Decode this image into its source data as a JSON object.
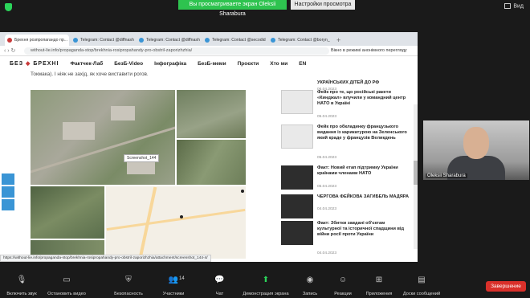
{
  "zoom": {
    "banner": "Вы просматриваете экран Oleksii Sharabura",
    "view_options": "Настройки просмотра",
    "view_mode": "Вид"
  },
  "browser": {
    "tabs": [
      {
        "label": "Брехня розпропагандо пр...",
        "active": true
      },
      {
        "label": "Telegram: Contact @diffnash"
      },
      {
        "label": "Telegram: Contact @diffnash"
      },
      {
        "label": "Telegram: Contact @secodid"
      },
      {
        "label": "Telegram: Contact @boryn_"
      }
    ],
    "new_tab": "+",
    "url": "without-lie.info/propaganda-stop/brekhnia-rosipropahandy-pro-obstril-zaporizhzhia/",
    "incognito": "Вікно в режимі анонімного перегляду",
    "status_url": "https://without-lie.info/propaganda-stop/brekhnia-rosipropahandy-pro-obstril-zaporizhzhia/attachment/screenshot_144-4/"
  },
  "site": {
    "logo_left": "БЕЗ",
    "logo_right": "БРЕХНІ",
    "nav": [
      "Фактчек-Лаб",
      "БезБ-Video",
      "Інфографіка",
      "БезБ-меми",
      "Проєкти",
      "Хто ми",
      "EN"
    ],
    "intro_text": "Токмака). І ніяк не захід, як хоче виставити рогов.",
    "tooltip": "Screenshot_144",
    "sidebar": [
      {
        "title": "УКРАЇНСЬКИХ ДІТЕЙ ДО РФ",
        "date": "06.04.2023"
      },
      {
        "title": "Фейк про те, що російські ракети «Кинджал» влучили у командний центр НАТО в Україні",
        "date": "05.04.2023"
      },
      {
        "title": "Фейк про обкладинку французького видання із карикатурою на Зеленського який краде у французів Великдень",
        "date": "05.04.2023"
      },
      {
        "title": "Факт: Новий етап підтримку України країнами членами НАТО",
        "date": "05.04.2023"
      },
      {
        "title": "ЧЕРГОВА ФЕЙКОВА ЗАГИБЕЛЬ МАДЯРА",
        "date": "04.04.2023"
      },
      {
        "title": "Факт: Збитки завдані об'єктам культурної та історичної спадщини від війни росії проти України",
        "date": "04.04.2023"
      }
    ]
  },
  "participant": {
    "name": "Oleksii Sharabura"
  },
  "toolbar": {
    "items": [
      {
        "icon": "mic-muted-icon",
        "label": "Включить звук"
      },
      {
        "icon": "video-icon",
        "label": "Остановить видео"
      },
      {
        "icon": "shield-icon",
        "label": "Безопасность"
      },
      {
        "icon": "participants-icon",
        "label": "Участники",
        "count": "14"
      },
      {
        "icon": "chat-icon",
        "label": "Чат"
      },
      {
        "icon": "share-screen-icon",
        "label": "Демонстрация экрана"
      },
      {
        "icon": "record-icon",
        "label": "Запись"
      },
      {
        "icon": "reactions-icon",
        "label": "Реакции"
      },
      {
        "icon": "apps-icon",
        "label": "Приложения"
      },
      {
        "icon": "whiteboard-icon",
        "label": "Доски сообщений"
      }
    ],
    "end": "Завершение"
  }
}
